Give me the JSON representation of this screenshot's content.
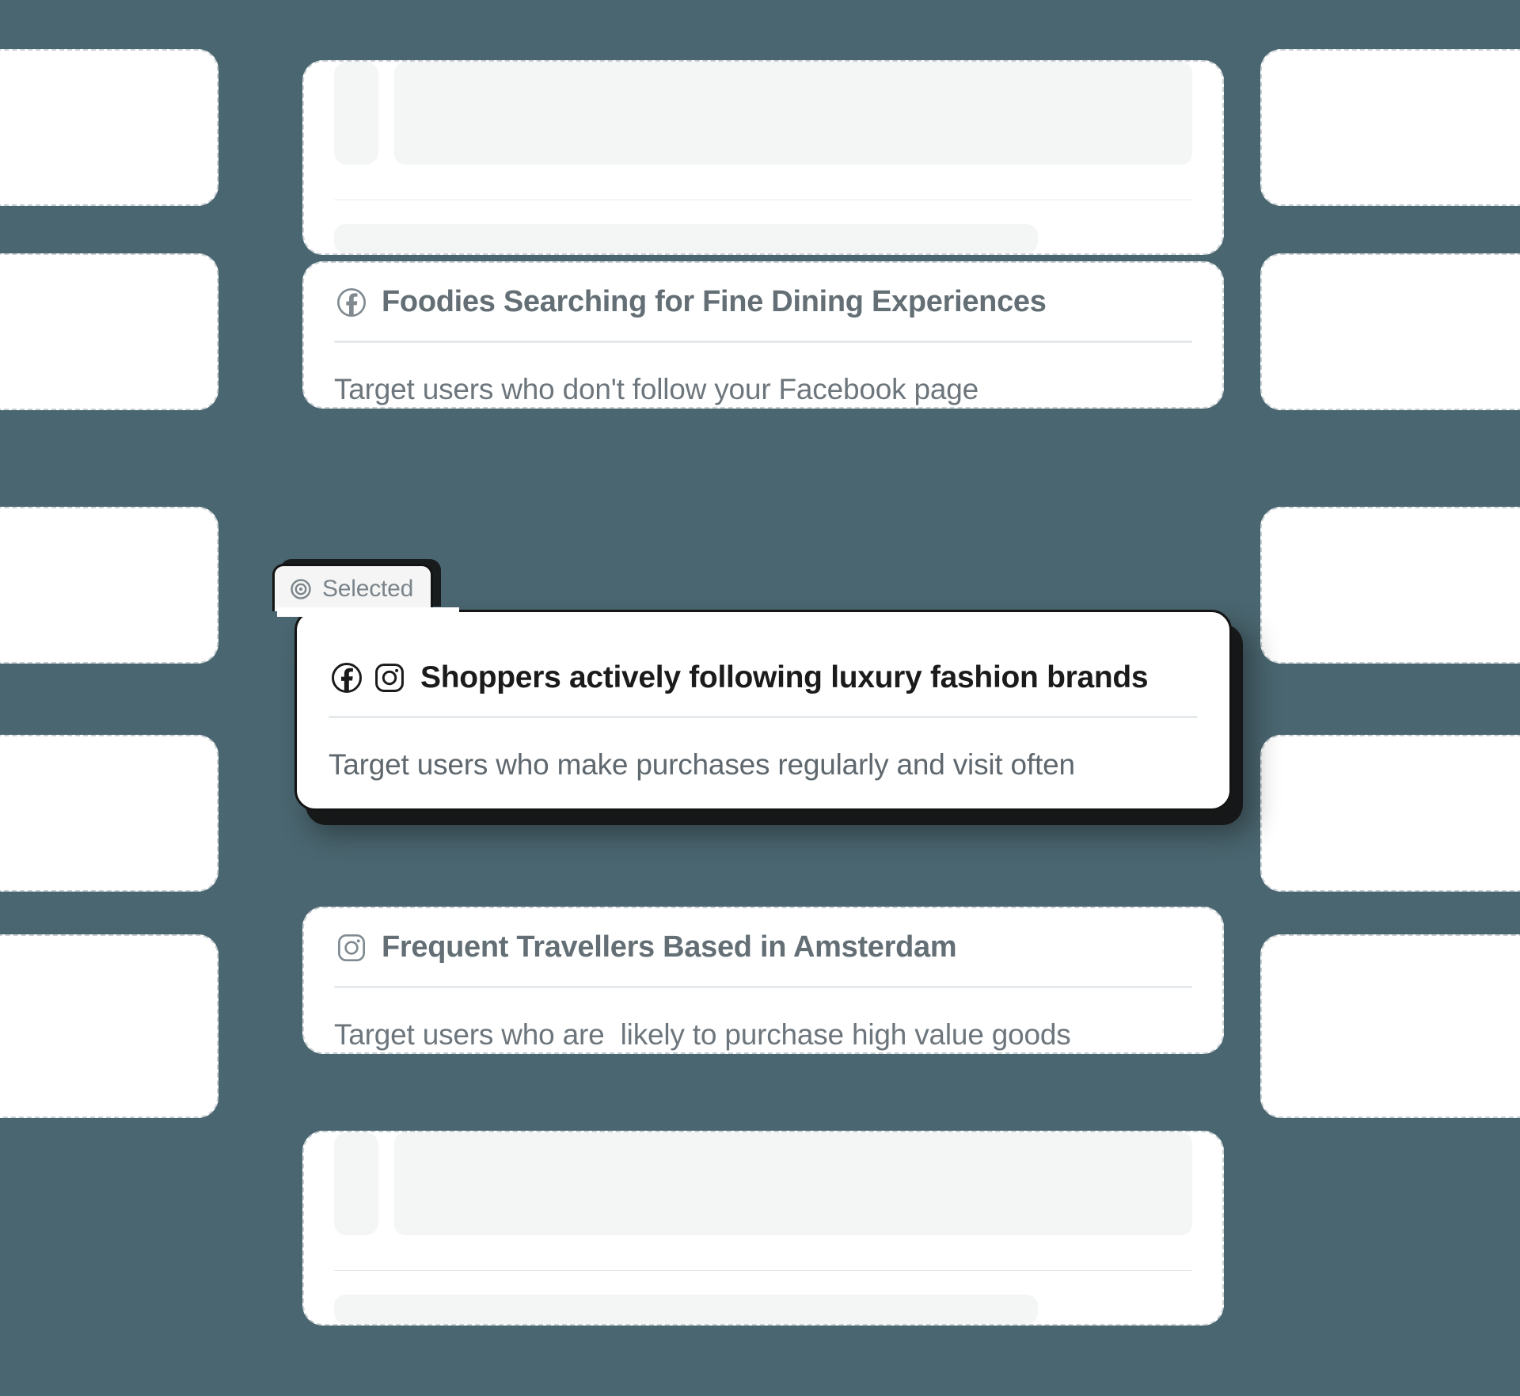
{
  "theme": {
    "background": "#4a6670",
    "card_bg": "#ffffff",
    "card_border": "#c9d0d4",
    "divider": "#e6e9ec",
    "skeleton_fill": "#f4f6f6",
    "title_gray": "#636f75",
    "desc_gray": "#6d767c",
    "selected_border": "#141414",
    "badge_bg": "#f5f5f5",
    "badge_text": "#7b848a"
  },
  "badge": {
    "label": "Selected",
    "icon": "target-icon"
  },
  "cards": [
    {
      "id": "skeleton-top",
      "type": "skeleton",
      "platforms": []
    },
    {
      "id": "foodies",
      "type": "content",
      "platforms": [
        "facebook-icon"
      ],
      "title": "Foodies Searching for Fine Dining Experiences",
      "description": "Target users who don't follow your Facebook page"
    },
    {
      "id": "luxury-shoppers",
      "type": "content",
      "state": "selected",
      "platforms": [
        "facebook-icon",
        "instagram-icon"
      ],
      "title": "Shoppers actively following luxury fashion brands",
      "description": "Target users who make purchases regularly and visit often"
    },
    {
      "id": "amsterdam-travellers",
      "type": "content",
      "platforms": [
        "instagram-icon"
      ],
      "title": "Frequent Travellers Based in Amsterdam",
      "description": "Target users who are  likely to purchase high value goods"
    },
    {
      "id": "skeleton-bottom",
      "type": "skeleton",
      "platforms": []
    }
  ],
  "side_cards": {
    "left_count": 5,
    "right_count": 5,
    "placeholder": ""
  }
}
